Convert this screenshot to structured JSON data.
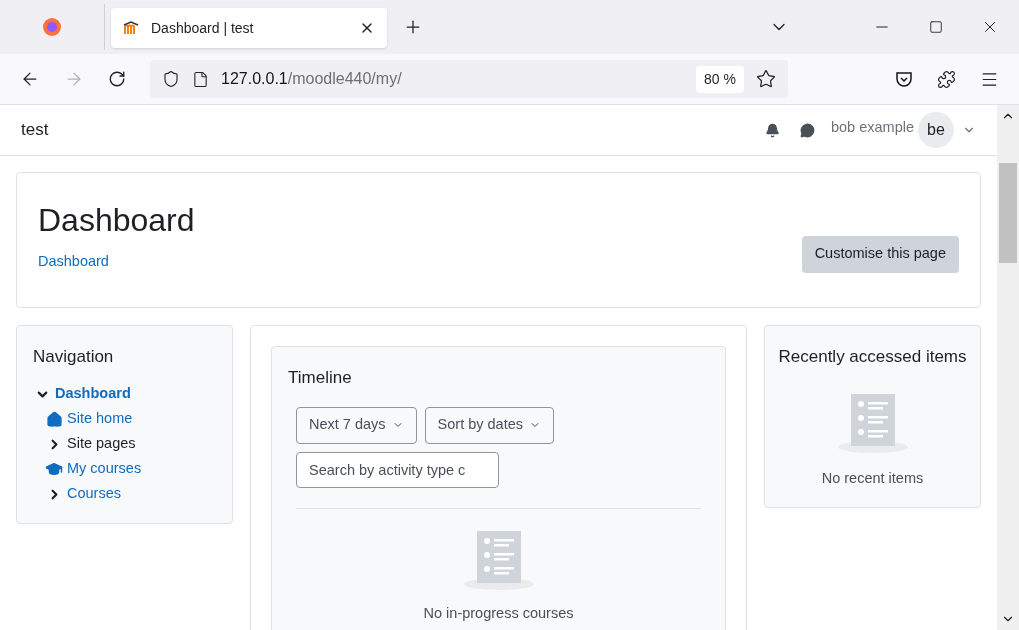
{
  "browser": {
    "tab": {
      "title": "Dashboard | test",
      "selected": true
    },
    "address": {
      "host": "127.0.0.1",
      "path": "/moodle440/my/"
    },
    "zoom": "80 %"
  },
  "header": {
    "site_name": "test",
    "user_name": "bob example",
    "avatar_initials": "be"
  },
  "page": {
    "title": "Dashboard",
    "breadcrumb": "Dashboard",
    "customise_button": "Customise this page"
  },
  "navigation": {
    "title": "Navigation",
    "items": [
      {
        "label": "Dashboard",
        "kind": "branch",
        "expanded": true,
        "link": true,
        "children": [
          {
            "label": "Site home",
            "kind": "home",
            "link": true
          },
          {
            "label": "Site pages",
            "kind": "branch",
            "expanded": false,
            "link": false
          },
          {
            "label": "My courses",
            "kind": "courses",
            "link": true
          },
          {
            "label": "Courses",
            "kind": "branch",
            "expanded": false,
            "link": true
          }
        ]
      }
    ]
  },
  "timeline": {
    "title": "Timeline",
    "filters": [
      "Next 7 days",
      "Sort by dates"
    ],
    "search": {
      "placeholder": "Search by activity type c"
    },
    "empty_text": "No in-progress courses"
  },
  "recent": {
    "title": "Recently accessed items",
    "empty_text": "No recent items"
  }
}
